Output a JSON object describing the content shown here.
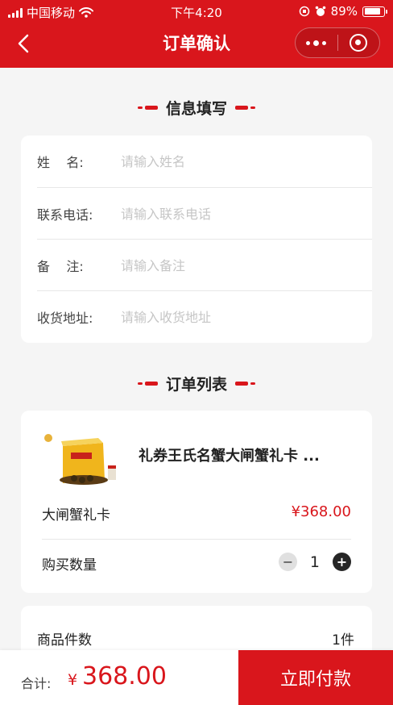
{
  "status_bar": {
    "carrier": "中国移动",
    "time": "下午4:20",
    "battery": "89%",
    "battery_level": 0.89
  },
  "nav": {
    "title": "订单确认",
    "back_icon": "chevron-left-icon",
    "more_icon": "more-dots-icon",
    "close_icon": "target-circle-icon"
  },
  "info_section": {
    "title": "信息填写",
    "fields": [
      {
        "label": "姓    名:",
        "placeholder": "请输入姓名",
        "value": ""
      },
      {
        "label": "联系电话:",
        "placeholder": "请输入联系电话",
        "value": ""
      },
      {
        "label": "备    注:",
        "placeholder": "请输入备注",
        "value": ""
      },
      {
        "label": "收货地址:",
        "placeholder": "请输入收货地址",
        "value": ""
      }
    ]
  },
  "order_section": {
    "title": "订单列表",
    "product": {
      "name": "礼券王氏名蟹大闸蟹礼卡 ...",
      "spec": "大闸蟹礼卡",
      "price": "¥368.00",
      "qty_label": "购买数量",
      "quantity": "1",
      "minus": "−",
      "plus": "+"
    }
  },
  "summary": {
    "count_label": "商品件数",
    "count_value": "1件"
  },
  "footer": {
    "total_label": "合计:",
    "currency": "¥",
    "total": "368.00",
    "pay_label": "立即付款"
  },
  "colors": {
    "accent": "#d9161c",
    "background": "#f5f5f5"
  }
}
